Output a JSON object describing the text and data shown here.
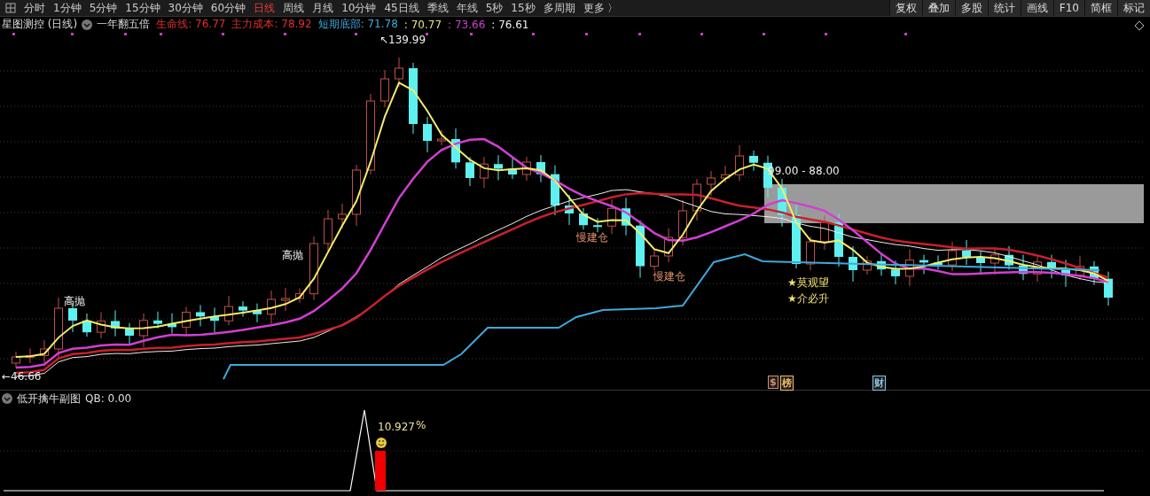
{
  "toolbar": {
    "periods": [
      {
        "label": "分时",
        "selected": false
      },
      {
        "label": "1分钟",
        "selected": false
      },
      {
        "label": "5分钟",
        "selected": false
      },
      {
        "label": "15分钟",
        "selected": false
      },
      {
        "label": "30分钟",
        "selected": false
      },
      {
        "label": "60分钟",
        "selected": false
      },
      {
        "label": "日线",
        "selected": true
      },
      {
        "label": "周线",
        "selected": false
      },
      {
        "label": "月线",
        "selected": false
      },
      {
        "label": "10分钟",
        "selected": false
      },
      {
        "label": "45日线",
        "selected": false
      },
      {
        "label": "季线",
        "selected": false
      },
      {
        "label": "年线",
        "selected": false
      },
      {
        "label": "5秒",
        "selected": false
      },
      {
        "label": "15秒",
        "selected": false
      },
      {
        "label": "多周期",
        "selected": false
      },
      {
        "label": "更多 〉",
        "selected": false
      }
    ],
    "buttons": [
      "复权",
      "叠加",
      "多股",
      "统计",
      "画线",
      "F10",
      "简框",
      "标记"
    ]
  },
  "legend": {
    "title": "星图测控 (日线)",
    "formula": "一年翻五倍",
    "values": [
      {
        "text": "生命线: 76.77",
        "color": "#e0302a"
      },
      {
        "text": "主力成本: 78.92",
        "color": "#e0302a"
      },
      {
        "text": "短期底部: 71.78",
        "color": "#3fa9dc"
      },
      {
        "text": ": 70.77",
        "color": "#e8e27a"
      },
      {
        "text": ": 73.66",
        "color": "#d23fd2"
      },
      {
        "text": ": 76.61",
        "color": "#f0f0f0"
      }
    ]
  },
  "main_chart": {
    "high_label": "↖139.99",
    "low_label": "←46.66",
    "zone_label": "99.00 - 88.00",
    "signals": [
      {
        "text": "高抛",
        "kind": "sell"
      },
      {
        "text": "高抛",
        "kind": "sell"
      },
      {
        "text": "慢建仓",
        "kind": "build"
      },
      {
        "text": "慢建仓",
        "kind": "build"
      },
      {
        "text": "★莫观望",
        "kind": "star"
      },
      {
        "text": "★介必升",
        "kind": "star"
      }
    ],
    "event_tags": [
      {
        "text": "$",
        "color": "#c89080"
      },
      {
        "text": "榜",
        "color": "#e8c070"
      },
      {
        "text": "财",
        "color": "#7fc8ee"
      }
    ]
  },
  "sub_chart": {
    "title": "低开擒牛副图",
    "reading": "QB: 0.00",
    "value_label": "10.927",
    "unit": "%"
  }
}
